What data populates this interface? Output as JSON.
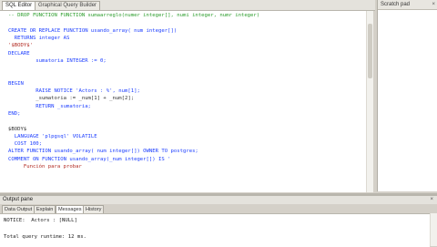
{
  "tabs": {
    "sql_editor": "SQL Editor",
    "graphical_query_builder": "Graphical Query Builder"
  },
  "scratch_pad": {
    "title": "Scratch pad",
    "close": "×"
  },
  "editor_lines": [
    {
      "text": "-- DROP FUNCTION FUNCTION sumaarreglo(numer integer[], numi integer, numr integer)",
      "style": "cm"
    },
    {
      "text": "",
      "style": "tx"
    },
    {
      "text": "CREATE OR REPLACE FUNCTION usando_array( num integer[])",
      "style": "kw"
    },
    {
      "text": "  RETURNS integer AS",
      "style": "kw"
    },
    {
      "text": "'$BODY$'",
      "style": "str"
    },
    {
      "text": "DECLARE",
      "style": "kw"
    },
    {
      "text": "         sumatoria INTEGER := 0;",
      "style": "kw"
    },
    {
      "text": "",
      "style": "tx"
    },
    {
      "text": "",
      "style": "tx"
    },
    {
      "text": "BEGIN",
      "style": "kw"
    },
    {
      "text": "         RAISE NOTICE 'Actors : %', num[1];",
      "style": "kw"
    },
    {
      "text": "         _sumatoria := _num[1] + _num[2];",
      "style": "tx"
    },
    {
      "text": "         RETURN _sumatoria;",
      "style": "kw"
    },
    {
      "text": "END;",
      "style": "kw"
    },
    {
      "text": "",
      "style": "tx"
    },
    {
      "text": "$BODY$",
      "style": "tx"
    },
    {
      "text": "  LANGUAGE 'plpgsql' VOLATILE",
      "style": "kw"
    },
    {
      "text": "  COST 100;",
      "style": "kw"
    },
    {
      "text": "ALTER FUNCTION usando_array( num integer[]) OWNER TO postgres;",
      "style": "kw"
    },
    {
      "text": "COMMENT ON FUNCTION usando_array(_num integer[]) IS '",
      "style": "kw"
    },
    {
      "text": "     Función para probar",
      "style": "str"
    }
  ],
  "output": {
    "title": "Output pane",
    "close": "×",
    "tabs": [
      "Data Output",
      "Explain",
      "Messages",
      "History"
    ],
    "active_tab": "Messages",
    "lines": [
      "NOTICE:  Actors : [NULL]",
      "",
      "Total query runtime: 12 ms."
    ]
  }
}
